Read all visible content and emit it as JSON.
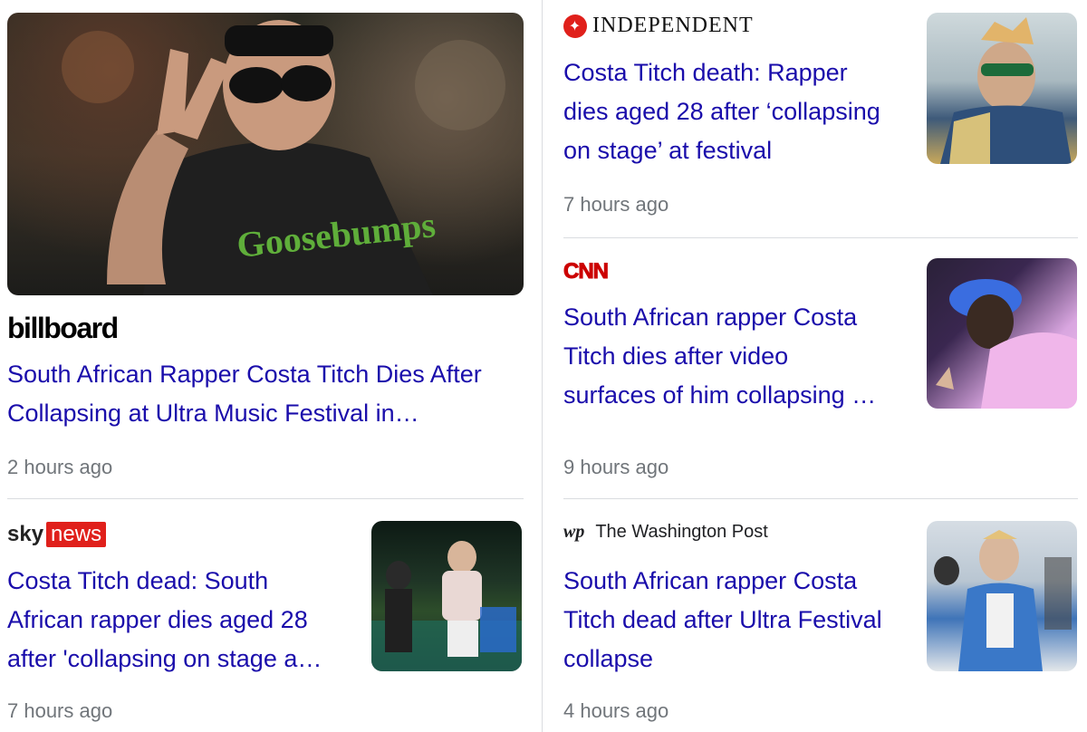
{
  "stories": {
    "billboard": {
      "source": "billboard",
      "headline_line1": "South African Rapper Costa Titch Dies After",
      "headline_line2": "Collapsing at Ultra Music Festival in…",
      "time": "2 hours ago",
      "image_text": "Goosebumps"
    },
    "independent": {
      "source": "INDEPENDENT",
      "headline_line1": "Costa Titch death: Rapper",
      "headline_line2": "dies aged 28 after ‘collapsing",
      "headline_line3": "on stage’ at festival",
      "time": "7 hours ago"
    },
    "cnn": {
      "source": "CNN",
      "headline_line1": "South African rapper Costa",
      "headline_line2": "Titch dies after video",
      "headline_line3": "surfaces of him collapsing …",
      "time": "9 hours ago"
    },
    "sky": {
      "source_sky": "sky",
      "source_news": "news",
      "headline_line1": "Costa Titch dead: South",
      "headline_line2": "African rapper dies aged 28",
      "headline_line3": "after 'collapsing on stage a…",
      "time": "7 hours ago"
    },
    "wapo": {
      "source_mark": "wp",
      "source": "The Washington Post",
      "headline_line1": "South African rapper Costa",
      "headline_line2": "Titch dead after Ultra Festival",
      "headline_line3": "collapse",
      "time": "4 hours ago"
    }
  },
  "colors": {
    "link": "#1a0dab",
    "meta": "#70757a",
    "divider": "#dadce0",
    "sky_red": "#e0201b",
    "cnn_red": "#cc0000"
  }
}
